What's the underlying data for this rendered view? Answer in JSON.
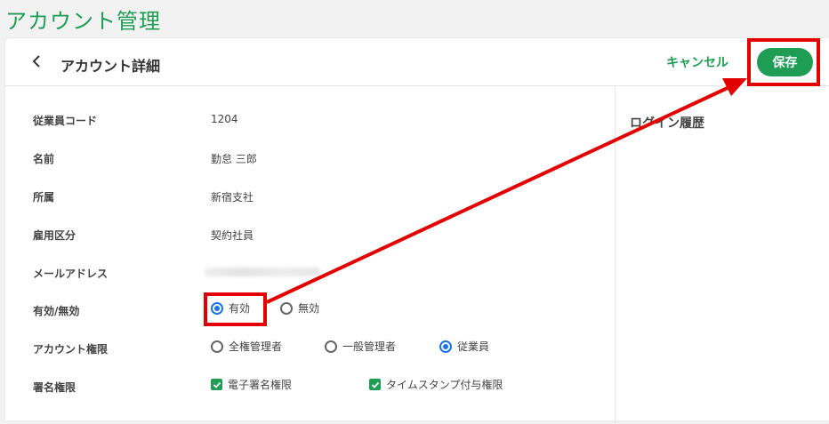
{
  "page_title": "アカウント管理",
  "header": {
    "title": "アカウント詳細",
    "cancel_label": "キャンセル",
    "save_label": "保存"
  },
  "side_panel": {
    "title": "ログイン履歴"
  },
  "fields": {
    "employee_code": {
      "label": "従業員コード",
      "value": "1204"
    },
    "name": {
      "label": "名前",
      "value": "勤怠 三郎"
    },
    "affiliation": {
      "label": "所属",
      "value": "新宿支社"
    },
    "employment_type": {
      "label": "雇用区分",
      "value": "契約社員"
    },
    "email": {
      "label": "メールアドレス"
    },
    "status": {
      "label": "有効/無効",
      "options": [
        {
          "label": "有効",
          "selected": true
        },
        {
          "label": "無効",
          "selected": false
        }
      ]
    },
    "role": {
      "label": "アカウント権限",
      "options": [
        {
          "label": "全権管理者",
          "selected": false
        },
        {
          "label": "一般管理者",
          "selected": false
        },
        {
          "label": "従業員",
          "selected": true
        }
      ]
    },
    "signature": {
      "label": "署名権限",
      "options": [
        {
          "label": "電子署名権限",
          "checked": true
        },
        {
          "label": "タイムスタンプ付与権限",
          "checked": true
        }
      ]
    }
  },
  "colors": {
    "accent": "#1f9d55",
    "radio_selected": "#1a73e8",
    "highlight": "#e30000"
  }
}
